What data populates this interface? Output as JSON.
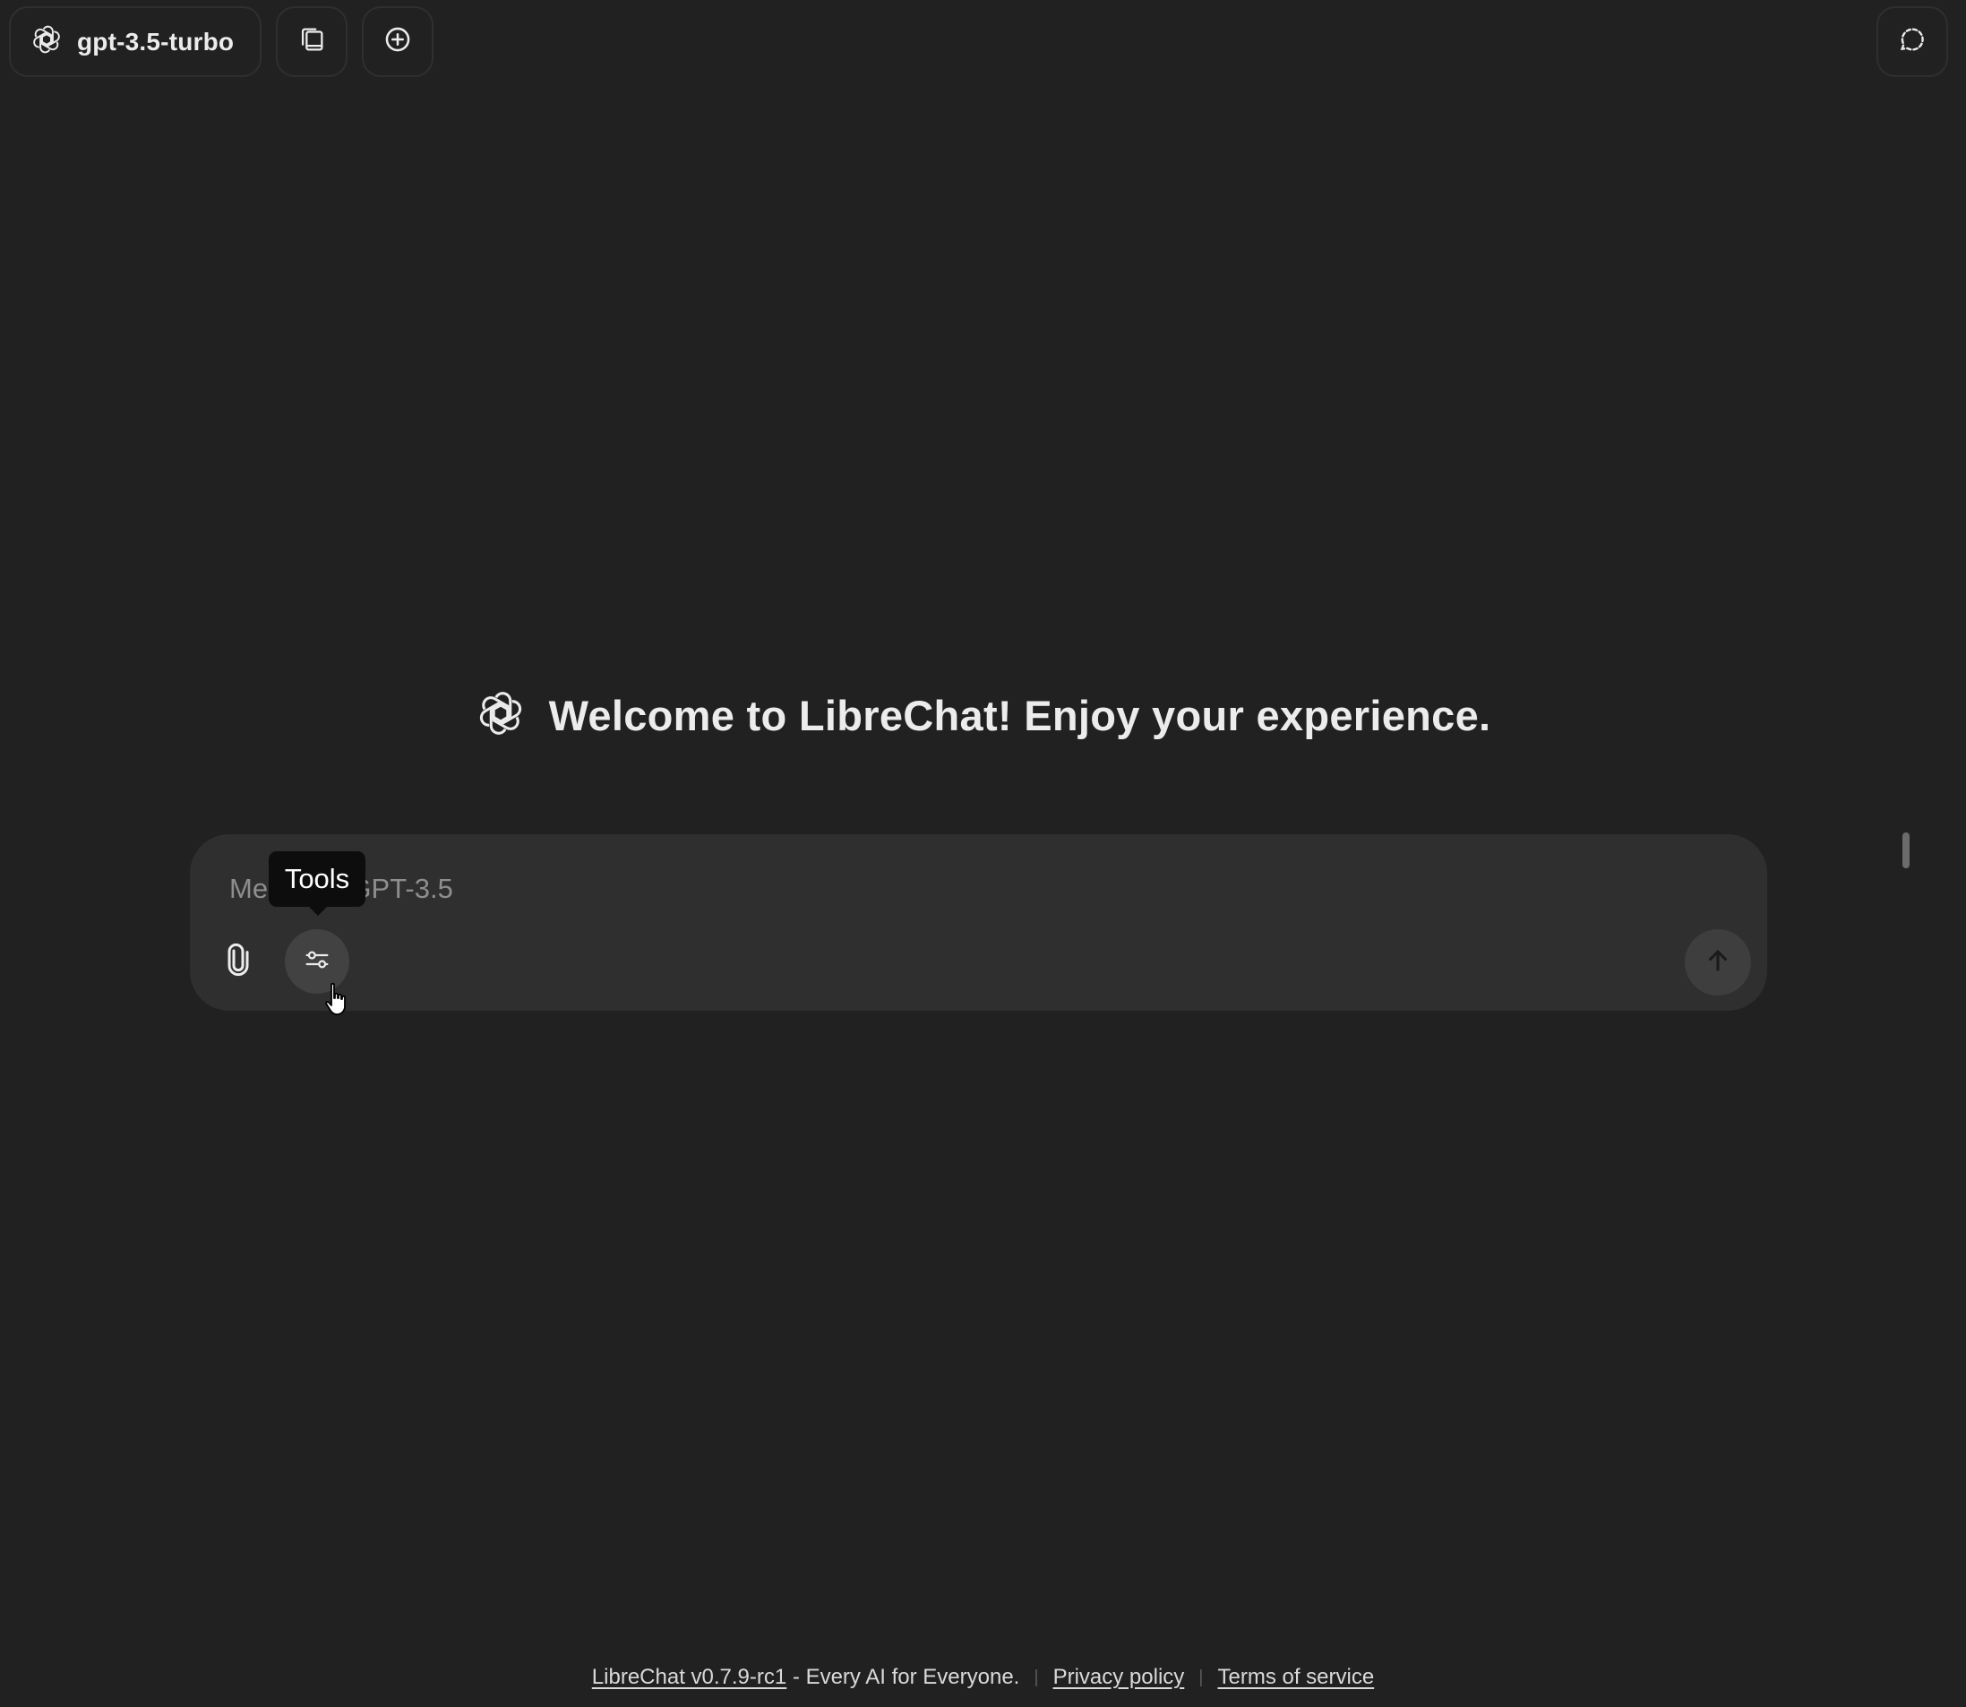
{
  "header": {
    "model_label": "gpt-3.5-turbo",
    "model_icon": "openai-logo-icon",
    "copy_icon": "copy-conversation-icon",
    "new_chat_icon": "new-chat-plus-icon",
    "temporary_chat_icon": "temporary-chat-icon"
  },
  "welcome": {
    "title": "Welcome to LibreChat! Enjoy your experience.",
    "icon": "openai-logo-icon"
  },
  "composer": {
    "placeholder": "Message GPT-3.5",
    "attach_icon": "paperclip-icon",
    "tools_icon": "sliders-icon",
    "send_icon": "arrow-up-icon",
    "tooltip": "Tools"
  },
  "footer": {
    "version_link": "LibreChat v0.7.9-rc1",
    "tagline": " - Every AI for Everyone.",
    "privacy_link": "Privacy policy",
    "terms_link": "Terms of service",
    "separator": "|"
  }
}
